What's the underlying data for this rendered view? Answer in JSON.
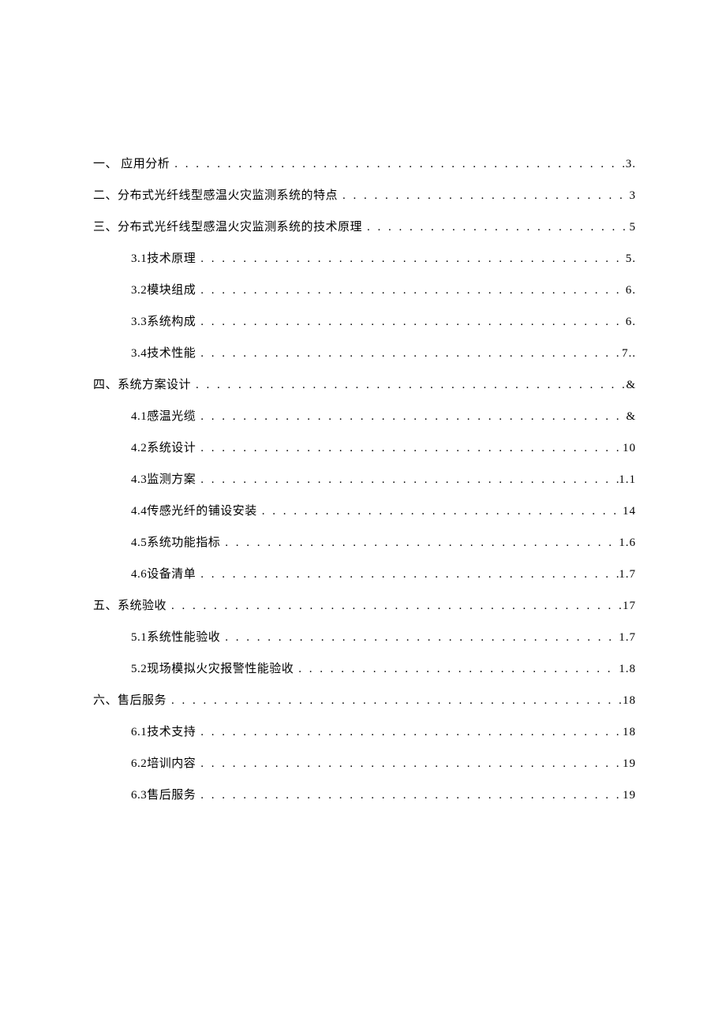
{
  "toc": [
    {
      "level": 1,
      "label": "一、  应用分析",
      "page": "3."
    },
    {
      "level": 1,
      "label": "二、分布式光纤线型感温火灾监测系统的特点",
      "page": "3"
    },
    {
      "level": 1,
      "label": "三、分布式光纤线型感温火灾监测系统的技术原理",
      "page": "5"
    },
    {
      "level": 2,
      "label": "3.1技术原理",
      "page": "5."
    },
    {
      "level": 2,
      "label": "3.2模块组成",
      "page": "6."
    },
    {
      "level": 2,
      "label": "3.3系统构成",
      "page": "6."
    },
    {
      "level": 2,
      "label": "3.4技术性能",
      "page": "7.."
    },
    {
      "level": 1,
      "label": "四、系统方案设计",
      "page": "&"
    },
    {
      "level": 2,
      "label": "4.1感温光缆",
      "page": "&"
    },
    {
      "level": 2,
      "label": "4.2系统设计",
      "page": "10"
    },
    {
      "level": 2,
      "label": "4.3监测方案",
      "page": "1.1"
    },
    {
      "level": 2,
      "label": "4.4传感光纤的铺设安装",
      "page": "14"
    },
    {
      "level": 2,
      "label": "4.5系统功能指标",
      "page": "1.6"
    },
    {
      "level": 2,
      "label": "4.6设备清单",
      "page": "1.7"
    },
    {
      "level": 1,
      "label": "五、系统验收",
      "page": "17"
    },
    {
      "level": 2,
      "label": "5.1系统性能验收",
      "page": "1.7"
    },
    {
      "level": 2,
      "label": "5.2现场模拟火灾报警性能验收",
      "page": "1.8"
    },
    {
      "level": 1,
      "label": "六、售后服务",
      "page": "18"
    },
    {
      "level": 2,
      "label": "6.1技术支持",
      "page": "18"
    },
    {
      "level": 2,
      "label": "6.2培训内容",
      "page": "19"
    },
    {
      "level": 2,
      "label": "6.3售后服务",
      "page": "19"
    }
  ]
}
